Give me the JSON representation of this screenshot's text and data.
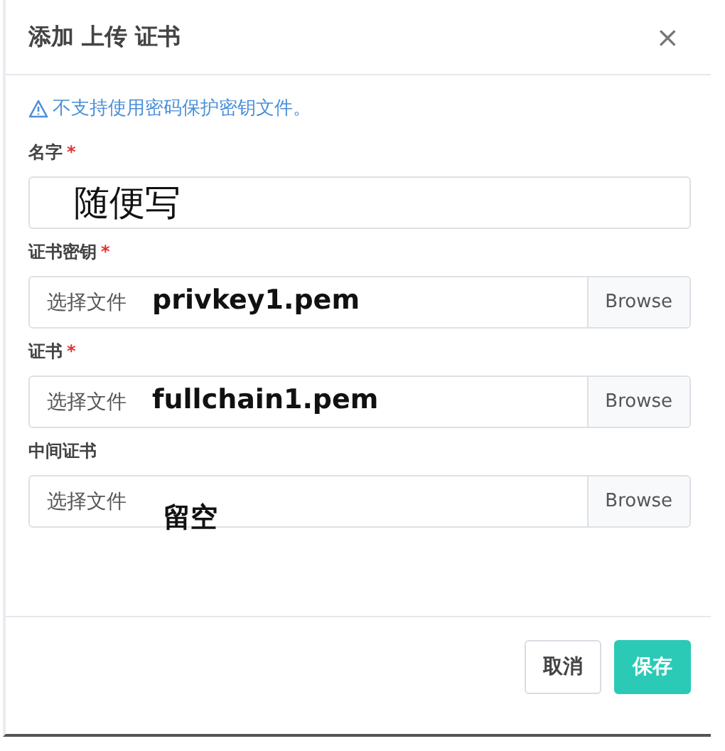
{
  "dialog": {
    "title": "添加 上传 证书",
    "close": "×"
  },
  "warning": "不支持使用密码保护密钥文件。",
  "fields": [
    {
      "kind": "text",
      "label": "名字",
      "mark": "*",
      "value": "随便写"
    },
    {
      "kind": "file",
      "label": "证书密钥",
      "mark": "*",
      "placeholder": "选择文件",
      "button": "Browse",
      "annotation": "privkey1.pem"
    },
    {
      "kind": "file",
      "label": "证书",
      "mark": "*",
      "placeholder": "选择文件",
      "button": "Browse",
      "annotation": "fullchain1.pem"
    },
    {
      "kind": "file",
      "label": "中间证书",
      "placeholder": "选择文件",
      "button": "Browse",
      "annotation": "留空"
    }
  ],
  "buttons": [
    {
      "label": "取消",
      "kind": "secondary"
    },
    {
      "label": "保存",
      "kind": "primary"
    }
  ]
}
